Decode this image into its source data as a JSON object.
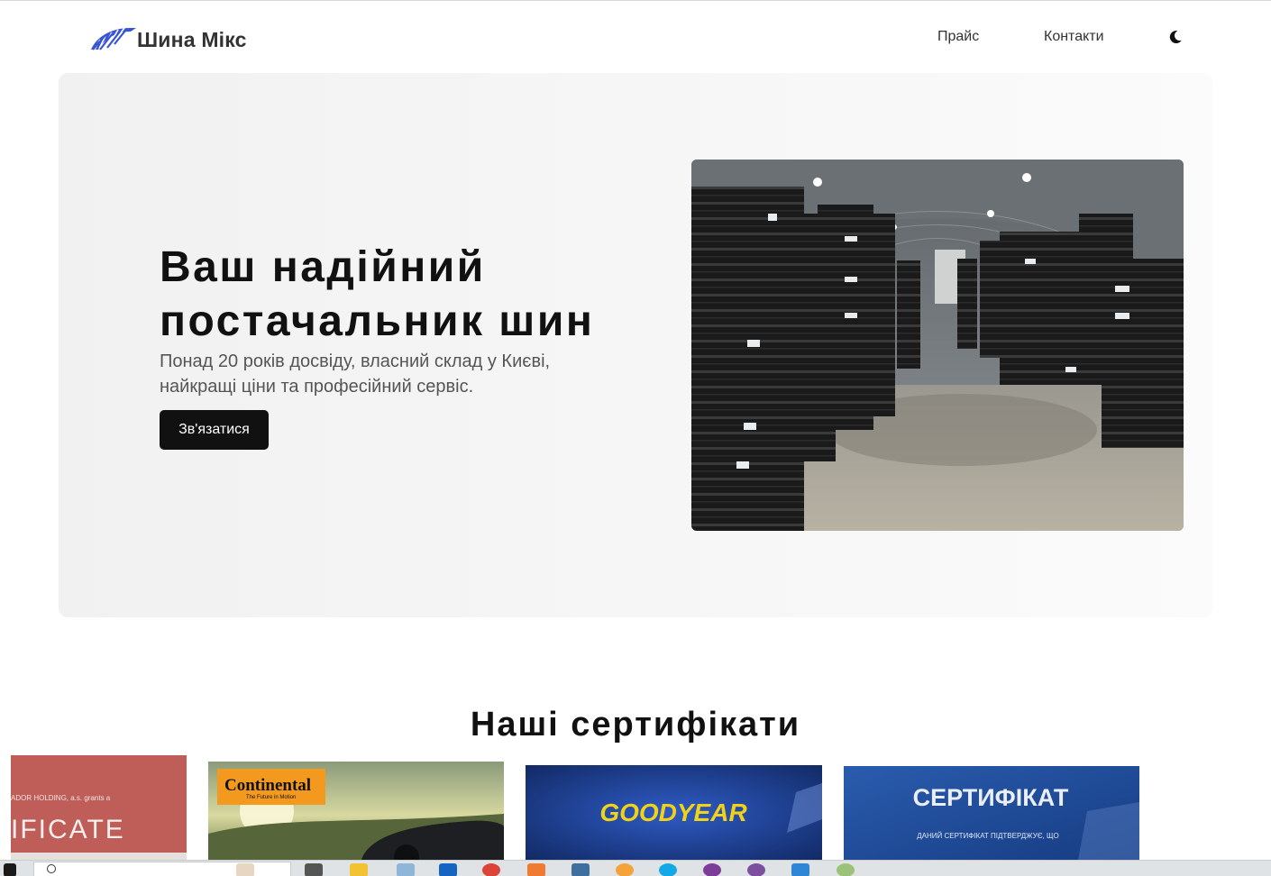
{
  "header": {
    "brand": "Шина Мікс",
    "nav": {
      "price": "Прайс",
      "contacts": "Контакти"
    },
    "theme_toggle_icon": "moon-icon"
  },
  "hero": {
    "title": "Ваш надійний постачальник шин",
    "subtitle": "Понад 20 років досвіду, власний склад у Києві, найкращі ціни та професійний сервіс.",
    "cta_label": "Зв'язатися",
    "image_alt": "tire-warehouse-photo"
  },
  "certificates": {
    "title": "Наші сертифікати",
    "items": [
      {
        "line1": "ADOR HOLDING, a.s. grants a",
        "line2": "IFICATE"
      },
      {
        "brand": "Continental",
        "tagline": "The Future in Motion"
      },
      {
        "brand": "GOODYEAR"
      },
      {
        "title": "СЕРТИФІКАТ",
        "text": "ДАНИЙ СЕРТИФІКАТ ПІДТВЕРДЖУЄ, ЩО"
      }
    ]
  },
  "colors": {
    "accent_dark": "#111111",
    "logo_blue": "#3a54d6",
    "hero_bg": "#f3f3f3"
  }
}
